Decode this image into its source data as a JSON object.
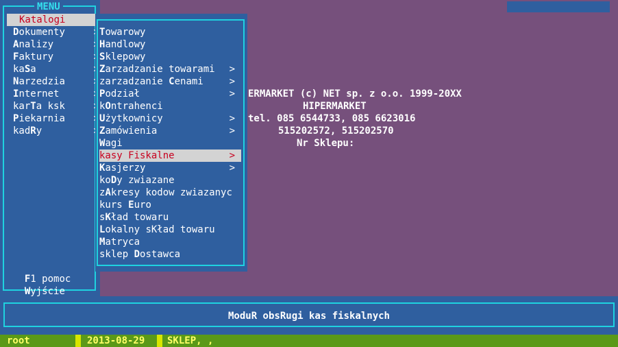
{
  "menu": {
    "title": "MENU",
    "items": [
      {
        "pre": "",
        "key": "",
        "post": "Katalogi",
        "arrow": ">"
      },
      {
        "pre": "",
        "key": "D",
        "post": "okumenty",
        "arrow": ">"
      },
      {
        "pre": "",
        "key": "A",
        "post": "nalizy",
        "arrow": ">"
      },
      {
        "pre": "",
        "key": "F",
        "post": "aktury",
        "arrow": ">"
      },
      {
        "pre": "ka",
        "key": "S",
        "post": "a",
        "arrow": ">"
      },
      {
        "pre": "",
        "key": "N",
        "post": "arzedzia",
        "arrow": ">"
      },
      {
        "pre": "",
        "key": "I",
        "post": "nternet",
        "arrow": ">"
      },
      {
        "pre": "kar",
        "key": "T",
        "post": "a ksk",
        "arrow": ">"
      },
      {
        "pre": "",
        "key": "P",
        "post": "iekarnia",
        "arrow": ">"
      },
      {
        "pre": "kad",
        "key": "R",
        "post": "y",
        "arrow": ">"
      }
    ],
    "help": {
      "pre": "",
      "key": "F",
      "post": "1 pomoc"
    },
    "exit": {
      "pre": "",
      "key": "W",
      "post": "yjście"
    }
  },
  "submenu": {
    "items": [
      {
        "pre": "",
        "key": "T",
        "post": "owarowy",
        "arrow": ""
      },
      {
        "pre": "",
        "key": "H",
        "post": "andlowy",
        "arrow": ""
      },
      {
        "pre": "",
        "key": "S",
        "post": "klepowy",
        "arrow": ""
      },
      {
        "pre": "",
        "key": "Z",
        "post": "arzadzanie towarami",
        "arrow": ">"
      },
      {
        "pre": "zarzadzanie ",
        "key": "C",
        "post": "enami",
        "arrow": ">"
      },
      {
        "pre": "",
        "key": "P",
        "post": "odział",
        "arrow": ">"
      },
      {
        "pre": "k",
        "key": "O",
        "post": "ntrahenci",
        "arrow": ""
      },
      {
        "pre": "",
        "key": "U",
        "post": "żytkownicy",
        "arrow": ">"
      },
      {
        "pre": "",
        "key": "Z",
        "post": "amówienia",
        "arrow": ">"
      },
      {
        "pre": "",
        "key": "W",
        "post": "agi",
        "arrow": ""
      },
      {
        "pre": "kasy Fiskalne",
        "key": "",
        "post": "",
        "arrow": ">"
      },
      {
        "pre": "",
        "key": "K",
        "post": "asjerzy",
        "arrow": ">"
      },
      {
        "pre": "ko",
        "key": "D",
        "post": "y zwiazane",
        "arrow": ""
      },
      {
        "pre": "z",
        "key": "A",
        "post": "kresy kodow zwiazanyc",
        "arrow": ""
      },
      {
        "pre": "kurs ",
        "key": "E",
        "post": "uro",
        "arrow": ""
      },
      {
        "pre": "s",
        "key": "K",
        "post": "ład towaru",
        "arrow": ""
      },
      {
        "pre": "",
        "key": "L",
        "post": "okalny sKład towaru",
        "arrow": ""
      },
      {
        "pre": "",
        "key": "M",
        "post": "atryca",
        "arrow": ""
      },
      {
        "pre": "sklep ",
        "key": "D",
        "post": "ostawca",
        "arrow": ""
      }
    ]
  },
  "info": {
    "line1": "ERMARKET (c) NET sp. z o.o. 1999-20XX",
    "line2": "HIPERMARKET",
    "line3": "tel. 085 6544733, 085 6623016",
    "line4": "515202572, 515202570",
    "line5": "Nr Sklepu:"
  },
  "status": {
    "message": "ModuR obsRugi kas fiskalnych"
  },
  "bottom": {
    "user": "root",
    "date": "2013-08-29",
    "shop": "SKLEP, ,"
  },
  "colors": {
    "background_blue": "#2f5f9f",
    "desktop_purple": "#76507c",
    "frame_cyan": "#1fd3e0",
    "highlight": "#d3d3d3",
    "highlight_text": "#c8001e",
    "statusbar_green": "#5a9918",
    "statusbar_text": "#ffff66"
  }
}
